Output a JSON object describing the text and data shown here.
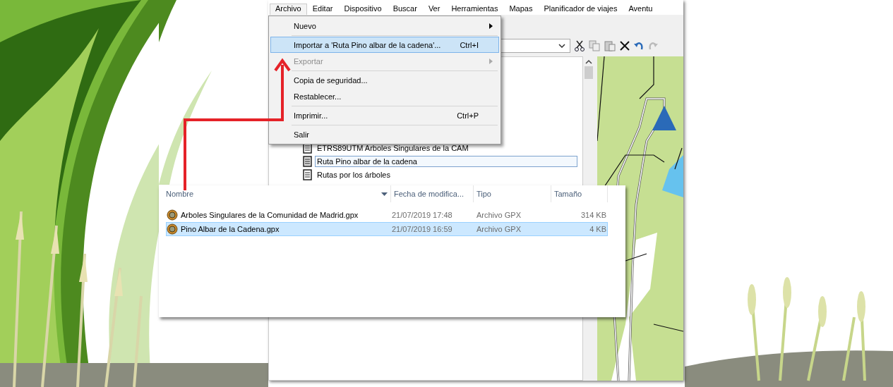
{
  "menu_bar": [
    {
      "label": "Archivo",
      "selected": true
    },
    {
      "label": "Editar",
      "selected": false
    },
    {
      "label": "Dispositivo",
      "selected": false
    },
    {
      "label": "Buscar",
      "selected": false
    },
    {
      "label": "Ver",
      "selected": false
    },
    {
      "label": "Herramientas",
      "selected": false
    },
    {
      "label": "Mapas",
      "selected": false
    },
    {
      "label": "Planificador de viajes",
      "selected": false
    },
    {
      "label": "Aventu",
      "selected": false
    }
  ],
  "file_menu": [
    {
      "label": "Nuevo",
      "submenu": true,
      "disabled": false,
      "selected": false,
      "separator_after": true
    },
    {
      "label": "Importar a 'Ruta Pino albar de la cadena'...",
      "shortcut": "Ctrl+I",
      "submenu": false,
      "disabled": false,
      "selected": true,
      "separator_after": false
    },
    {
      "label": "Exportar",
      "submenu": true,
      "disabled": true,
      "selected": false,
      "separator_after": true
    },
    {
      "label": "Copia de seguridad...",
      "submenu": false,
      "disabled": false,
      "selected": false,
      "separator_after": false
    },
    {
      "label": "Restablecer...",
      "submenu": false,
      "disabled": false,
      "selected": false,
      "separator_after": true
    },
    {
      "label": "Imprimir...",
      "shortcut": "Ctrl+P",
      "submenu": false,
      "disabled": false,
      "selected": false,
      "separator_after": true
    },
    {
      "label": "Salir",
      "submenu": false,
      "disabled": false,
      "selected": false,
      "separator_after": false
    }
  ],
  "tree": [
    {
      "label": "ETRS89UTM Arboles Singulares  de la CAM",
      "selected": false
    },
    {
      "label": "Ruta Pino albar de la cadena",
      "selected": true
    },
    {
      "label": "Rutas por los árboles",
      "selected": false
    }
  ],
  "file_list": {
    "columns": [
      {
        "label": "Nombre",
        "sorted": true
      },
      {
        "label": "Fecha de modifica...",
        "sorted": false
      },
      {
        "label": "Tipo",
        "sorted": false
      },
      {
        "label": "Tamaño",
        "sorted": false
      }
    ],
    "rows": [
      {
        "name": "Arboles Singulares de la Comunidad de Madrid.gpx",
        "date": "21/07/2019 17:48",
        "type": "Archivo GPX",
        "size": "314 KB",
        "selected": false
      },
      {
        "name": "Pino Albar de la Cadena.gpx",
        "date": "21/07/2019 16:59",
        "type": "Archivo GPX",
        "size": "4 KB",
        "selected": true
      }
    ]
  }
}
